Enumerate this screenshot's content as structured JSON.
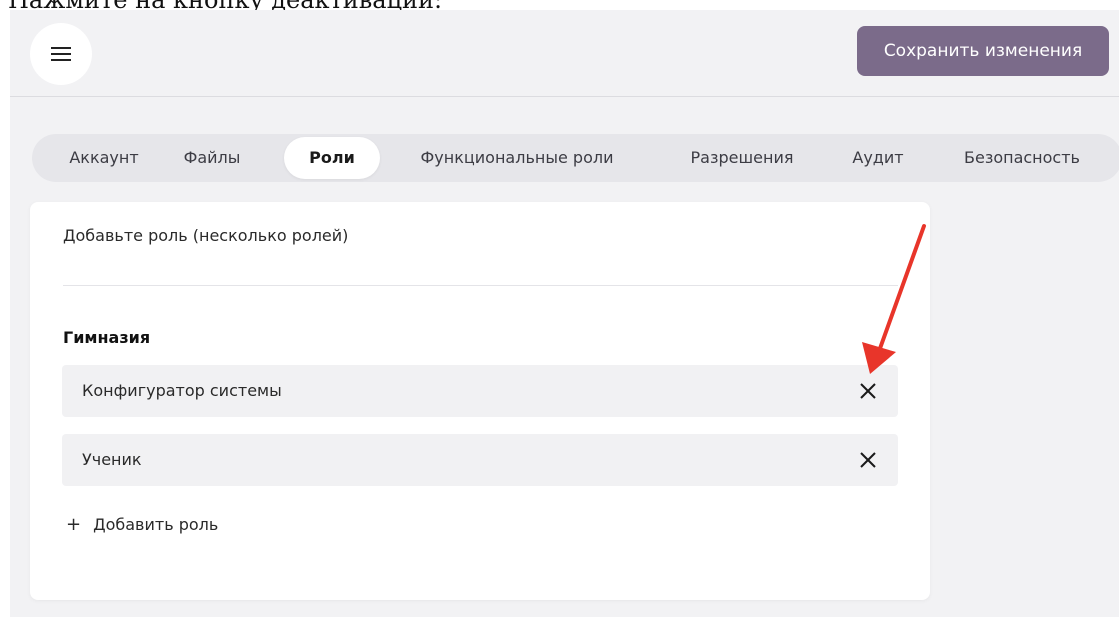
{
  "caption": "Нажмите на кнопку деактивации:",
  "header": {
    "menu_icon": "hamburger-menu-icon",
    "save_label": "Сохранить изменения",
    "save_color": "#7b6b8a"
  },
  "tabs": [
    {
      "label": "Аккаунт",
      "active": false
    },
    {
      "label": "Файлы",
      "active": false
    },
    {
      "label": "Роли",
      "active": true
    },
    {
      "label": "Функциональные роли",
      "active": false
    },
    {
      "label": "Разрешения",
      "active": false
    },
    {
      "label": "Аудит",
      "active": false
    },
    {
      "label": "Безопасность",
      "active": false
    }
  ],
  "card": {
    "add_hint": "Добавьте роль (несколько ролей)",
    "group_title": "Гимназия",
    "roles": [
      {
        "label": "Конфигуратор системы",
        "remove_icon": "close-icon"
      },
      {
        "label": "Ученик",
        "remove_icon": "close-icon"
      }
    ],
    "add_role_label": "Добавить роль",
    "add_role_icon": "plus-icon"
  },
  "annotation": {
    "type": "arrow",
    "color": "#e8352a",
    "target": "remove-role-button-0"
  }
}
